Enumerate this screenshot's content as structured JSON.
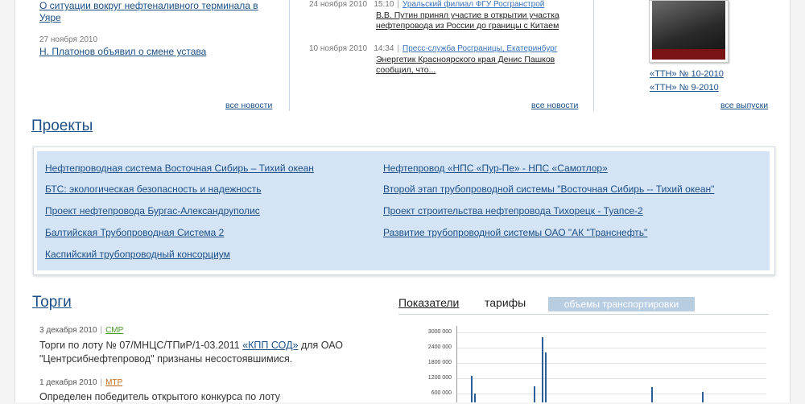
{
  "news_left": [
    {
      "title": "О ситуации вокруг нефтеналивного терминала в Уяре"
    },
    {
      "date": "27 ноября 2010",
      "title": "Н. Платонов объявил о смене устава"
    }
  ],
  "news_left_all": "все новости",
  "news_mid": [
    {
      "date": "24 ноября 2010",
      "time": "15:10",
      "source": "Уральский филиал ФГУ Росгранстрой",
      "text": "В.В. Путин принял участие в открытии участка нефтепровода из России до границы с Китаем"
    },
    {
      "date": "10 ноября 2010",
      "time": "14:34",
      "source": "Пресс-служба Росграницы, Екатеринбург",
      "text": "Энергетик Красноярского края Денис Пашков сообщил, что..."
    }
  ],
  "news_mid_all": "все новости",
  "magazine": {
    "issues": [
      "«ТТН» № 10-2010",
      "«ТТН» № 9-2010"
    ],
    "all_label": "все выпуски"
  },
  "projects": {
    "title": "Проекты",
    "left": [
      "Нефтепроводная система Восточная Сибирь – Тихий океан",
      "БТС: экологическая безопасность и надежность",
      "Проект нефтепровода Бургас-Александруполис",
      "Балтийская Трубопроводная Система 2",
      "Каспийский трубопроводный консорциум"
    ],
    "right": [
      "Нефтепровод «НПС «Пур-Пе» - НПС «Самотлор»",
      "Второй этап трубопроводной системы \"Восточная Сибирь -- Тихий океан\"",
      "Проект строительства нефтепровода Тихорецк - Туапсе-2",
      "Развитие трубопроводной системы ОАО \"АК \"Транснефть\""
    ]
  },
  "torgi": {
    "title": "Торги",
    "items": [
      {
        "date": "3 декабря 2010",
        "tag": "СМР",
        "link": "«КПП СОД»",
        "text_before": "Торги по лоту № 07/МНЦС/ТПиР/1-03.2011",
        "text_after": "для ОАО \"Центрсибнефтепровод\" признаны несостоявшимися."
      },
      {
        "date": "1 декабря 2010",
        "tag": "МТР",
        "text": "Определен победитель открытого конкурса по лоту"
      }
    ]
  },
  "indicators": {
    "tabs": [
      "Показатели",
      "тарифы",
      "объемы транспортировки"
    ],
    "active_tab_color": "#b9cde2"
  },
  "chart_data": {
    "type": "bar",
    "y_ticks": [
      "3000 000",
      "2400 000",
      "1800 000",
      "1200 000",
      "600 000"
    ],
    "ylim": [
      0,
      3000000
    ],
    "values": [
      1300000,
      600000,
      900000,
      2800000,
      2200000,
      850000,
      650000
    ]
  }
}
